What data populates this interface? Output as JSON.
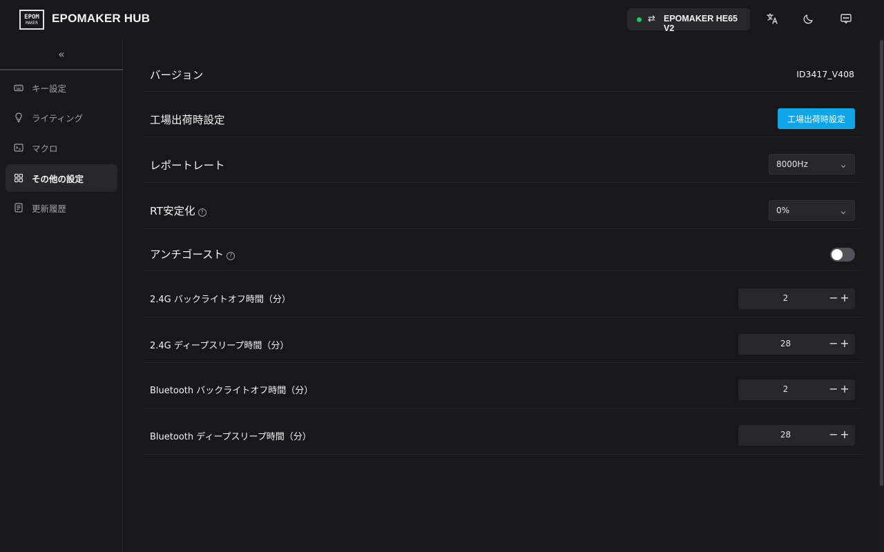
{
  "app": {
    "logo_line1": "EPOM",
    "logo_line2": "MAKER",
    "title": "EPOMAKER HUB"
  },
  "device": {
    "name": "EPOMAKER HE65 V2",
    "status_color": "#22c55e"
  },
  "header_icons": [
    "translate-icon",
    "moon-icon",
    "message-icon"
  ],
  "sidebar": {
    "collapse_icon": "«",
    "items": [
      {
        "label": "キー設定",
        "icon": "keyboard-icon",
        "active": false
      },
      {
        "label": "ライティング",
        "icon": "bulb-icon",
        "active": false
      },
      {
        "label": "マクロ",
        "icon": "terminal-icon",
        "active": false
      },
      {
        "label": "その他の設定",
        "icon": "grid-icon",
        "active": true
      },
      {
        "label": "更新履歴",
        "icon": "document-icon",
        "active": false
      }
    ]
  },
  "settings": {
    "version": {
      "label": "バージョン",
      "value": "ID3417_V408"
    },
    "factory_reset": {
      "label": "工場出荷時設定",
      "button": "工場出荷時設定"
    },
    "report_rate": {
      "label": "レポートレート",
      "value": "8000Hz"
    },
    "rt_stabilization": {
      "label": "RT安定化",
      "value": "0%"
    },
    "anti_ghost": {
      "label": "アンチゴースト",
      "enabled": false
    },
    "g24_backlight_off": {
      "label": "2.4G バックライトオフ時間（分）",
      "value": "2"
    },
    "g24_deep_sleep": {
      "label": "2.4G ディープスリープ時間（分）",
      "value": "28"
    },
    "bt_backlight_off": {
      "label": "Bluetooth バックライトオフ時間（分）",
      "value": "2"
    },
    "bt_deep_sleep": {
      "label": "Bluetooth ディープスリープ時間（分）",
      "value": "28"
    }
  },
  "colors": {
    "accent": "#0ea5e9",
    "background": "#18181b",
    "panel": "#27272a"
  }
}
